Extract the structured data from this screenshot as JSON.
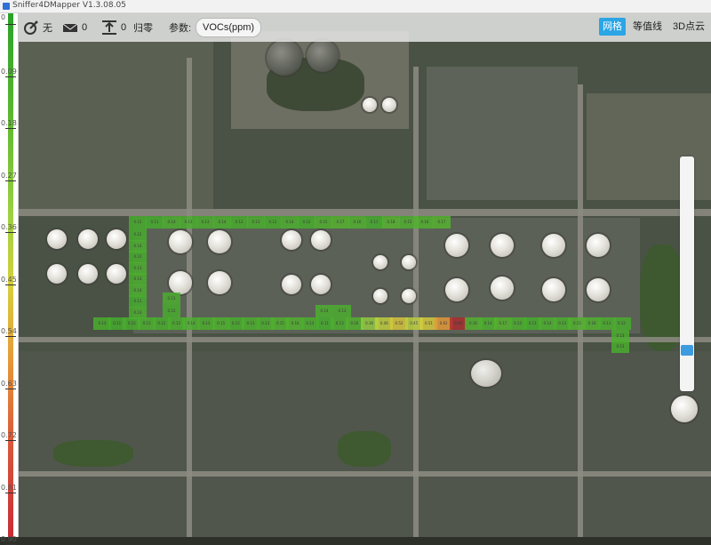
{
  "window": {
    "title": "Sniffer4DMapper V1.3.08.05"
  },
  "toolbar": {
    "route_label": "无",
    "mail_count": "0",
    "upload_count": "0",
    "reset_label": "归零",
    "param_label": "参数:",
    "param_value": "VOCs(ppm)",
    "views": [
      "网格",
      "等值线",
      "3D点云"
    ],
    "active_view": "网格"
  },
  "scale": {
    "ticks": [
      "0",
      "0.09",
      "0.18",
      "0.27",
      "0.36",
      "0.45",
      "0.54",
      "0.63",
      "0.72",
      "0.81",
      "0.90"
    ]
  },
  "heatmap": {
    "top_row_values": [
      "0.12",
      "0.11",
      "0.14",
      "0.13",
      "0.13",
      "0.14",
      "0.12",
      "0.13",
      "0.12",
      "0.14",
      "0.12",
      "0.15",
      "0.17",
      "0.16",
      "0.11",
      "0.18",
      "0.15",
      "0.16",
      "0.17"
    ],
    "bottom_row_values": [
      "0.13",
      "0.11",
      "0.12",
      "0.13",
      "0.12",
      "0.13",
      "0.14",
      "0.13",
      "0.15",
      "0.12",
      "0.13",
      "0.13",
      "0.15",
      "0.16",
      "0.13",
      "0.11",
      "0.13",
      "0.16",
      "0.36",
      "0.46",
      "0.52",
      "0.45",
      "0.51",
      "0.62",
      "0.86",
      "0.16",
      "0.14",
      "0.17",
      "0.13",
      "0.11",
      "0.14",
      "0.13",
      "0.15",
      "0.16",
      "0.13",
      "0.12"
    ],
    "left_column_values": [
      "0.12",
      "0.14",
      "0.12",
      "0.13",
      "0.13",
      "0.14",
      "0.11",
      "0.13"
    ],
    "mid_column_values": [
      "0.13",
      "0.12"
    ]
  },
  "colors": {
    "low": "#2aa12a",
    "mid": "#d6d03c",
    "high": "#c92d37",
    "accent": "#2aa5e6"
  }
}
